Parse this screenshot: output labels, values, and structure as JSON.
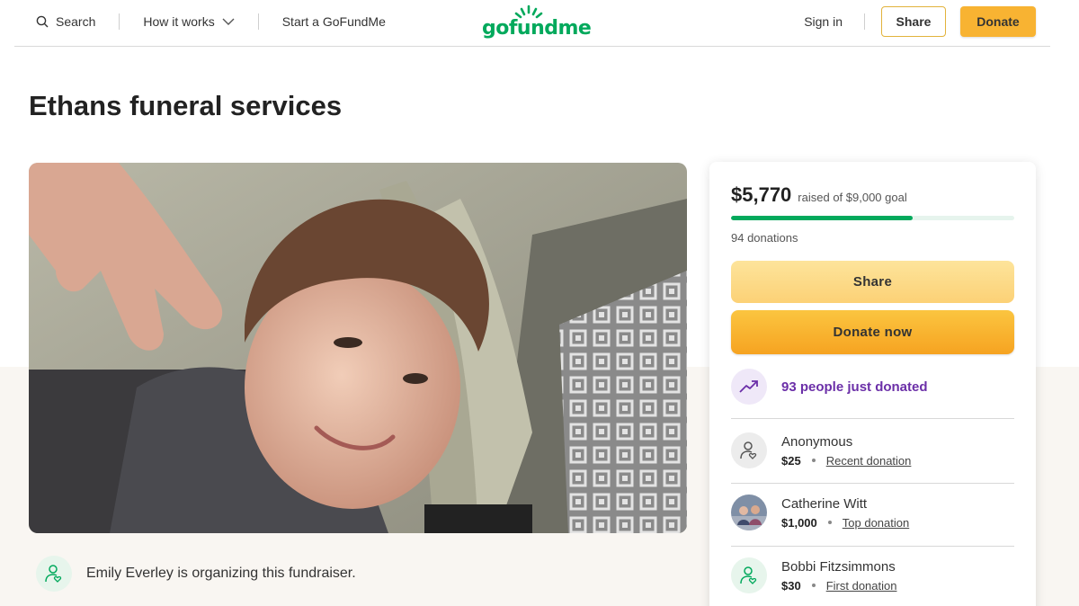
{
  "header": {
    "search_label": "Search",
    "how_it_works_label": "How it works",
    "start_label": "Start a GoFundMe",
    "logo_text": "gofundme",
    "signin_label": "Sign in",
    "share_label": "Share",
    "donate_label": "Donate"
  },
  "campaign": {
    "title": "Ethans funeral services",
    "organizer_text": "Emily Everley is organizing this fundraiser."
  },
  "card": {
    "amount": "$5,770",
    "goal_text": "raised of $9,000 goal",
    "progress": 0.641,
    "donations_count": "94 donations",
    "share_label": "Share",
    "donate_label": "Donate now",
    "recent_text": "93 people just donated"
  },
  "donors": [
    {
      "name": "Anonymous",
      "amount": "$25",
      "tag": "Recent donation",
      "avatar": "person-heart-icon"
    },
    {
      "name": "Catherine Witt",
      "amount": "$1,000",
      "tag": "Top donation",
      "avatar": "photo"
    },
    {
      "name": "Bobbi Fitzsimmons",
      "amount": "$30",
      "tag": "First donation",
      "avatar": "person-heart-icon"
    }
  ],
  "colors": {
    "brand_green": "#02a95c",
    "donate_orange": "#f8b332",
    "recent_purple": "#6b2fa8"
  }
}
